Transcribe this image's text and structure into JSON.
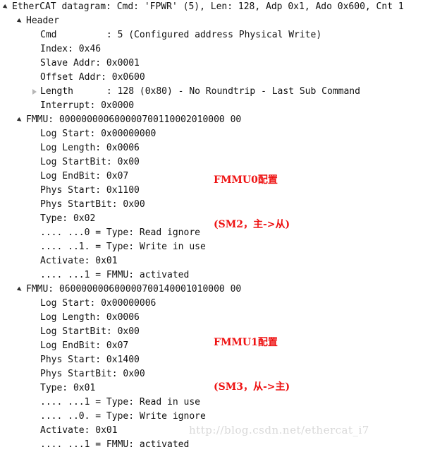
{
  "window": {
    "title": "EtherCAT datagram detail tree",
    "background": "#ffffff",
    "text_color": "#111111",
    "annotation_color": "#ee1111",
    "watermark_color": "#d9d9d9"
  },
  "tree": {
    "rows": [
      {
        "indent": 0,
        "twisty": "open",
        "text": "EtherCAT datagram: Cmd: 'FPWR' (5), Len: 128, Adp 0x1, Ado 0x600, Cnt 1"
      },
      {
        "indent": 1,
        "twisty": "open",
        "text": "Header"
      },
      {
        "indent": 2,
        "twisty": "none",
        "text": "Cmd         : 5 (Configured address Physical Write)"
      },
      {
        "indent": 2,
        "twisty": "none",
        "text": "Index: 0x46"
      },
      {
        "indent": 2,
        "twisty": "none",
        "text": "Slave Addr: 0x0001"
      },
      {
        "indent": 2,
        "twisty": "none",
        "text": "Offset Addr: 0x0600"
      },
      {
        "indent": 2,
        "twisty": "closed",
        "text": "Length      : 128 (0x80) - No Roundtrip - Last Sub Command"
      },
      {
        "indent": 2,
        "twisty": "none",
        "text": "Interrupt: 0x0000"
      },
      {
        "indent": 1,
        "twisty": "open",
        "text": "FMMU: 000000000600000700110002010000 00"
      },
      {
        "indent": 2,
        "twisty": "none",
        "text": "Log Start: 0x00000000"
      },
      {
        "indent": 2,
        "twisty": "none",
        "text": "Log Length: 0x0006"
      },
      {
        "indent": 2,
        "twisty": "none",
        "text": "Log StartBit: 0x00"
      },
      {
        "indent": 2,
        "twisty": "none",
        "text": "Log EndBit: 0x07"
      },
      {
        "indent": 2,
        "twisty": "none",
        "text": "Phys Start: 0x1100"
      },
      {
        "indent": 2,
        "twisty": "none",
        "text": "Phys StartBit: 0x00"
      },
      {
        "indent": 2,
        "twisty": "none",
        "text": "Type: 0x02"
      },
      {
        "indent": 2,
        "twisty": "none",
        "text": ".... ...0 = Type: Read ignore"
      },
      {
        "indent": 2,
        "twisty": "none",
        "text": ".... ..1. = Type: Write in use"
      },
      {
        "indent": 2,
        "twisty": "none",
        "text": "Activate: 0x01"
      },
      {
        "indent": 2,
        "twisty": "none",
        "text": ".... ...1 = FMMU: activated"
      },
      {
        "indent": 1,
        "twisty": "open",
        "text": "FMMU: 060000000600000700140001010000 00"
      },
      {
        "indent": 2,
        "twisty": "none",
        "text": "Log Start: 0x00000006"
      },
      {
        "indent": 2,
        "twisty": "none",
        "text": "Log Length: 0x0006"
      },
      {
        "indent": 2,
        "twisty": "none",
        "text": "Log StartBit: 0x00"
      },
      {
        "indent": 2,
        "twisty": "none",
        "text": "Log EndBit: 0x07"
      },
      {
        "indent": 2,
        "twisty": "none",
        "text": "Phys Start: 0x1400"
      },
      {
        "indent": 2,
        "twisty": "none",
        "text": "Phys StartBit: 0x00"
      },
      {
        "indent": 2,
        "twisty": "none",
        "text": "Type: 0x01"
      },
      {
        "indent": 2,
        "twisty": "none",
        "text": ".... ...1 = Type: Read in use"
      },
      {
        "indent": 2,
        "twisty": "none",
        "text": ".... ..0. = Type: Write ignore"
      },
      {
        "indent": 2,
        "twisty": "none",
        "text": "Activate: 0x01"
      },
      {
        "indent": 2,
        "twisty": "none",
        "text": ".... ...1 = FMMU: activated"
      }
    ]
  },
  "annotations": [
    {
      "line1": "FMMU0配置",
      "line2": "(SM2，主->从)"
    },
    {
      "line1": "FMMU1配置",
      "line2": "(SM3，从->主)"
    }
  ],
  "watermark": {
    "text": "http://blog.csdn.net/ethercat_i7"
  }
}
